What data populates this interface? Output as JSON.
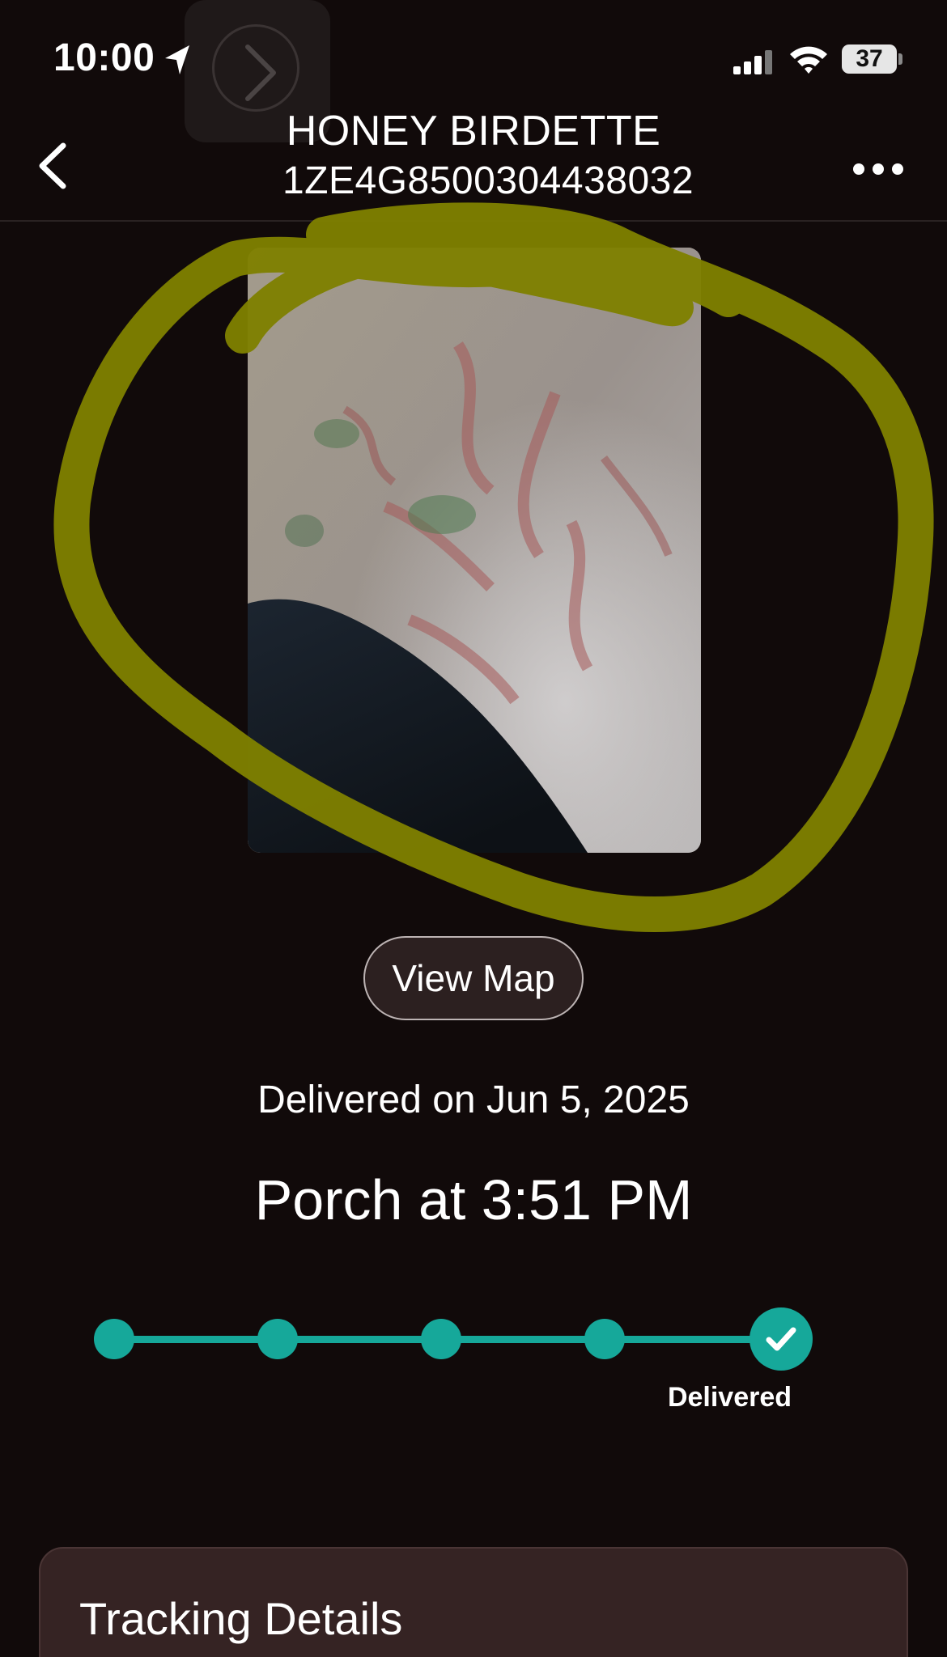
{
  "status_bar": {
    "time": "10:00",
    "battery": "37",
    "icons": [
      "location-arrow-icon",
      "signal-icon",
      "wifi-icon",
      "battery-icon"
    ]
  },
  "header": {
    "title": "HONEY BIRDETTE",
    "tracking_number": "1ZE4G8500304438032",
    "back_icon": "chevron-left-icon",
    "more_icon": "ellipsis-icon"
  },
  "photo": {
    "annotation_color": "#7f8000"
  },
  "view_map": {
    "label": "View Map"
  },
  "delivery": {
    "date_text": "Delivered on Jun 5, 2025",
    "place_text": "Porch at 3:51 PM"
  },
  "progress": {
    "steps_total": 5,
    "steps_completed": 5,
    "current_label": "Delivered",
    "accent": "#16a89a"
  },
  "tracking_details": {
    "title": "Tracking Details"
  },
  "theme": {
    "background": "#110a0a",
    "card": "#352323"
  }
}
